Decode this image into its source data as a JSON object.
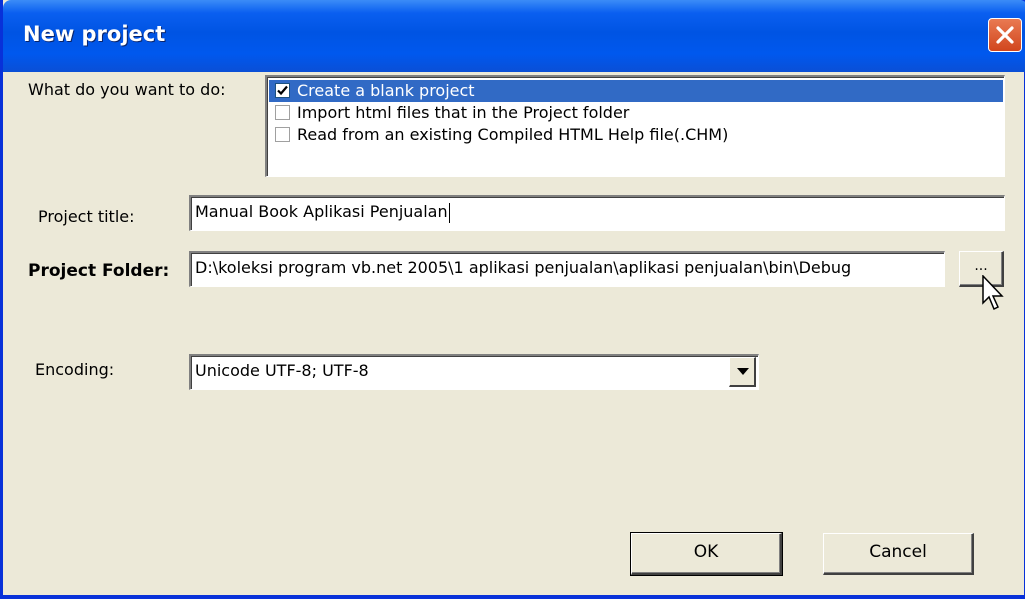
{
  "window": {
    "title": "New project",
    "close_icon": "close-icon"
  },
  "action": {
    "label": "What do you want to do:",
    "options": [
      {
        "label": "Create a blank project",
        "checked": true,
        "selected": true
      },
      {
        "label": "Import html files that in the Project folder",
        "checked": false,
        "selected": false
      },
      {
        "label": "Read from an existing Compiled HTML Help file(.CHM)",
        "checked": false,
        "selected": false
      }
    ]
  },
  "project_title": {
    "label": "Project title:",
    "value": "Manual Book Aplikasi Penjualan"
  },
  "project_folder": {
    "label": "Project Folder:",
    "value": "D:\\koleksi program vb.net 2005\\1 aplikasi penjualan\\aplikasi penjualan\\bin\\Debug",
    "browse_label": "..."
  },
  "encoding": {
    "label": "Encoding:",
    "value": "Unicode UTF-8; UTF-8",
    "dropdown_icon": "chevron-down-icon"
  },
  "buttons": {
    "ok": "OK",
    "cancel": "Cancel"
  },
  "colors": {
    "titlebar": "#0054e3",
    "selection": "#316ac5",
    "close": "#d1461e",
    "face": "#ece9d8"
  }
}
